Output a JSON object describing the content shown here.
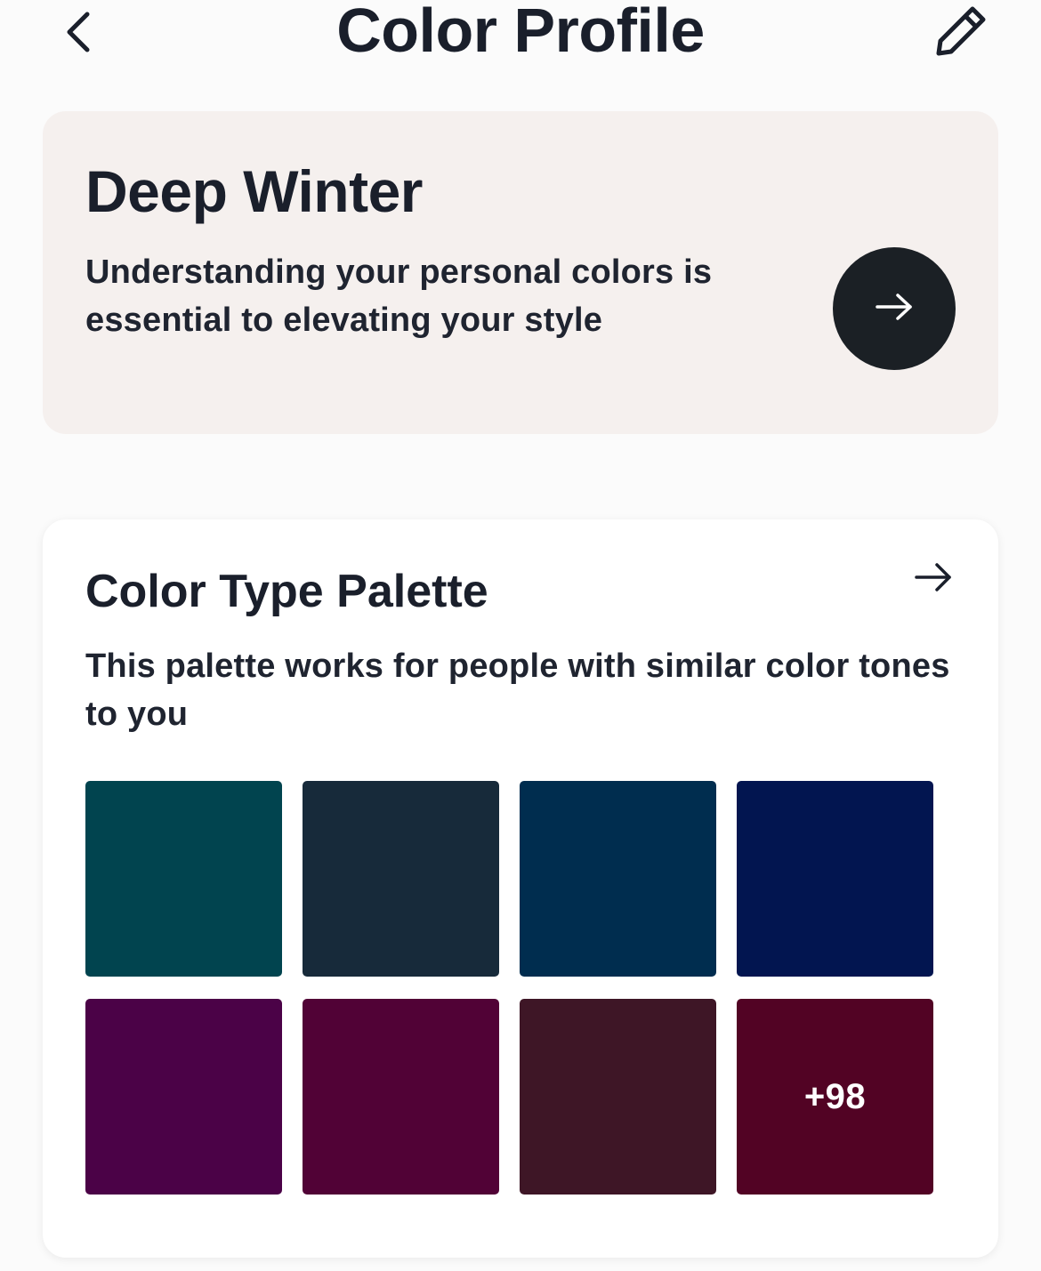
{
  "header": {
    "title": "Color Profile",
    "back_icon": "chevron-left-icon",
    "edit_icon": "pencil-icon"
  },
  "profile": {
    "name": "Deep Winter",
    "description": "Understanding your personal colors is essential to elevating your style",
    "action_icon": "arrow-right-icon"
  },
  "palette": {
    "title": "Color Type Palette",
    "description": "This palette works for people with similar color tones to you",
    "action_icon": "arrow-right-icon",
    "swatches": [
      {
        "color": "#01444f"
      },
      {
        "color": "#172a3a"
      },
      {
        "color": "#002d4f"
      },
      {
        "color": "#021550"
      },
      {
        "color": "#4b0247"
      },
      {
        "color": "#510236"
      },
      {
        "color": "#3e1626"
      },
      {
        "color": "#520324",
        "more_label": "+98"
      }
    ]
  },
  "colors": {
    "background": "#fbfbfb",
    "profile_card": "#f5f0ee",
    "dark_button": "#1b2025",
    "text": "#1a1f2b"
  }
}
